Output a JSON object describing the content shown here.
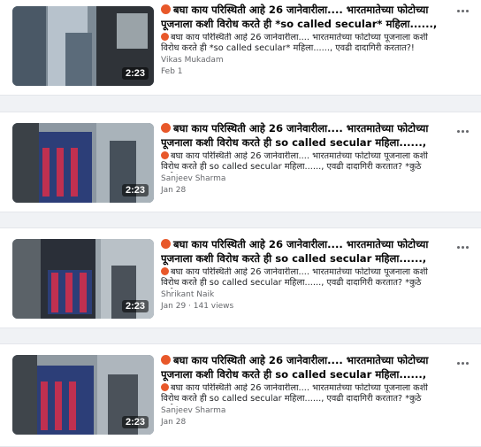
{
  "colors": {
    "page_bg": "#f0f2f5",
    "card_bg": "#ffffff",
    "meta_text": "#65676b",
    "emoji": "#e8582a"
  },
  "videos": [
    {
      "duration": "2:23",
      "emoji_icon": "angry-face-icon",
      "title": "बघा काय परिस्थिती आहे 26 जानेवारीला.... भारतमातेच्या फोटोच्या पूजनाला कशी विरोध करते ही *so called secular* महिला......, एवढी...",
      "description": "बघा काय परिस्थिती आहे 26 जानेवारीला.... भारतमातेच्या फोटोच्या पूजनाला कशी विरोध करते ही *so called secular* महिला......, एवढी दादागिरी करतात?! महाराष्ट्रात...",
      "author": "Vikas Mukadam",
      "meta": "Feb 1"
    },
    {
      "duration": "2:23",
      "emoji_icon": "angry-face-icon",
      "title": "बघा काय परिस्थिती आहे 26 जानेवारीला.... भारतमातेच्या फोटोच्या पूजनाला कशी विरोध करते ही so called secular महिला......, एवढी...",
      "description": "बघा काय परिस्थिती आहे 26 जानेवारीला.... भारतमातेच्या फोटोच्या पूजनाला कशी विरोध करते ही so called secular महिला......, एवढी दादागिरी करतात? *कुठे आहेत...",
      "author": "Sanjeev Sharma",
      "meta": "Jan 28"
    },
    {
      "duration": "2:23",
      "emoji_icon": "angry-face-icon",
      "title": "बघा काय परिस्थिती आहे 26 जानेवारीला.... भारतमातेच्या फोटोच्या पूजनाला कशी विरोध करते ही so called secular महिला......, एवढी...",
      "description": "बघा काय परिस्थिती आहे 26 जानेवारीला.... भारतमातेच्या फोटोच्या पूजनाला कशी विरोध करते ही so called secular महिला......, एवढी दादागिरी करतात? *कुठे आहेत...",
      "author": "Shrikant Naik",
      "meta": "Jan 29 · 141 views"
    },
    {
      "duration": "2:23",
      "emoji_icon": "angry-face-icon",
      "title": "बघा काय परिस्थिती आहे 26 जानेवारीला.... भारतमातेच्या फोटोच्या पूजनाला कशी विरोध करते ही so called secular महिला......, एवढी...",
      "description": "बघा काय परिस्थिती आहे 26 जानेवारीला.... भारतमातेच्या फोटोच्या पूजनाला कशी विरोध करते ही so called secular महिला......, एवढी दादागिरी करतात? *कुठे आहेत...",
      "author": "Sanjeev Sharma",
      "meta": "Jan 28"
    }
  ]
}
